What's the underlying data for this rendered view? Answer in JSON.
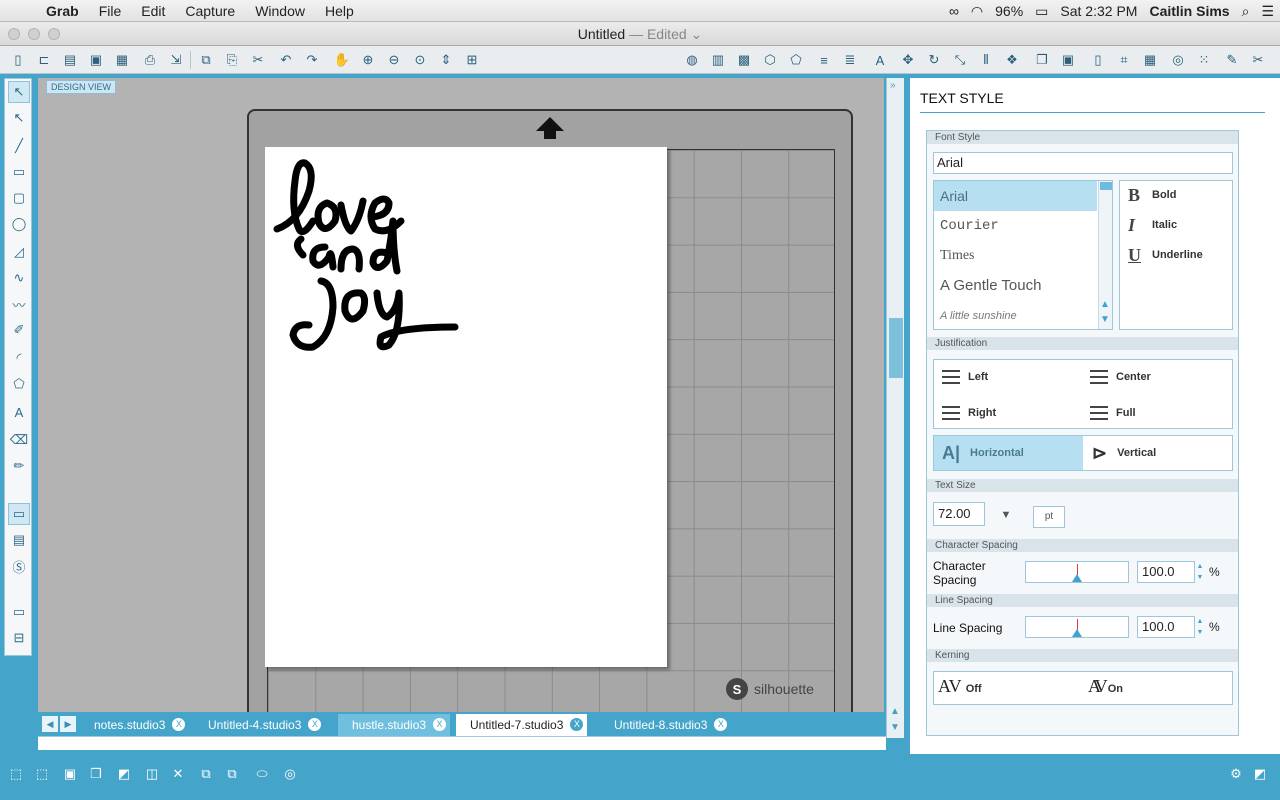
{
  "menubar": {
    "app": "Grab",
    "menus": [
      "File",
      "Edit",
      "Capture",
      "Window",
      "Help"
    ],
    "battery": "96%",
    "datetime": "Sat 2:32 PM",
    "user": "Caitlin Sims"
  },
  "window": {
    "title": "Untitled",
    "edited": "— Edited ⌄"
  },
  "canvas": {
    "view_label": "DESIGN VIEW",
    "brand": "silhouette",
    "brand_logo": "S"
  },
  "tabs": {
    "items": [
      {
        "label": "notes.studio3",
        "state": "normal"
      },
      {
        "label": "Untitled-4.studio3",
        "state": "normal"
      },
      {
        "label": "hustle.studio3",
        "state": "highlight"
      },
      {
        "label": "Untitled-7.studio3",
        "state": "current"
      },
      {
        "label": "Untitled-8.studio3",
        "state": "normal"
      }
    ],
    "close": "X"
  },
  "panel": {
    "title": "TEXT STYLE",
    "sections": {
      "font_style": "Font Style",
      "justification": "Justification",
      "text_size": "Text Size",
      "character_spacing": "Character Spacing",
      "line_spacing": "Line Spacing",
      "kerning": "Kerning"
    },
    "font_input": "Arial",
    "fonts": [
      "Arial",
      "Courier",
      "Times",
      "A Gentle Touch",
      "A little sunshine"
    ],
    "selected_font": "Arial",
    "styles": {
      "bold": "Bold",
      "italic": "Italic",
      "underline": "Underline"
    },
    "justification": {
      "left": "Left",
      "center": "Center",
      "right": "Right",
      "full": "Full"
    },
    "orientation": {
      "horizontal": "Horizontal",
      "vertical": "Vertical",
      "selected": "Horizontal"
    },
    "text_size": {
      "value": "72.00",
      "unit": "pt"
    },
    "char_spacing": {
      "label": "Character Spacing",
      "value": "100.0",
      "unit": "%"
    },
    "line_spacing": {
      "label": "Line Spacing",
      "value": "100.0",
      "unit": "%"
    },
    "kerning": {
      "off": "Off",
      "on": "On",
      "glyph": "AV"
    }
  },
  "colors": {
    "accent": "#45a4c9",
    "selection": "#b6e0f2",
    "mat": "#a2a2a2"
  }
}
